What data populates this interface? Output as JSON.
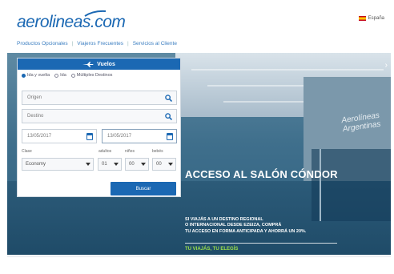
{
  "header": {
    "logo": "aerolineas.com",
    "language": "España"
  },
  "nav": {
    "items": [
      "Productos Opcionales",
      "Viajeros Frecuentes",
      "Servicios al Cliente"
    ]
  },
  "widget": {
    "title": "Vuelos",
    "trip_types": [
      {
        "label": "Ida y vuelta",
        "selected": true
      },
      {
        "label": "Ida",
        "selected": false
      },
      {
        "label": "Múltiples Destinos",
        "selected": false
      }
    ],
    "origin_placeholder": "Origen",
    "destination_placeholder": "Destino",
    "depart_date": "13/05/2017",
    "return_date": "13/05/2017",
    "class_label": "Clase",
    "class_value": "Economy",
    "pax_labels": {
      "adults": "adultos",
      "children": "niños",
      "infants": "bebés"
    },
    "adults": "01",
    "children": "00",
    "infants": "00",
    "search_button": "Buscar"
  },
  "hero": {
    "title": "ACCESO AL SALÓN CÓNDOR",
    "copy_line1": "SI VIAJÁS A UN DESTINO REGIONAL",
    "copy_line2": "O INTERNACIONAL DESDE EZEIZA, COMPRÁ",
    "copy_line3": "TU ACCESO EN FORMA ANTICIPADA Y AHORRÁ UN 20%.",
    "slogan": "TU VIAJÁS, TU ELEGÍS",
    "wall_sign": "Aerolíneas Argentinas"
  },
  "colors": {
    "brand_blue": "#1b68b3",
    "slogan_green": "#9ae04a"
  }
}
